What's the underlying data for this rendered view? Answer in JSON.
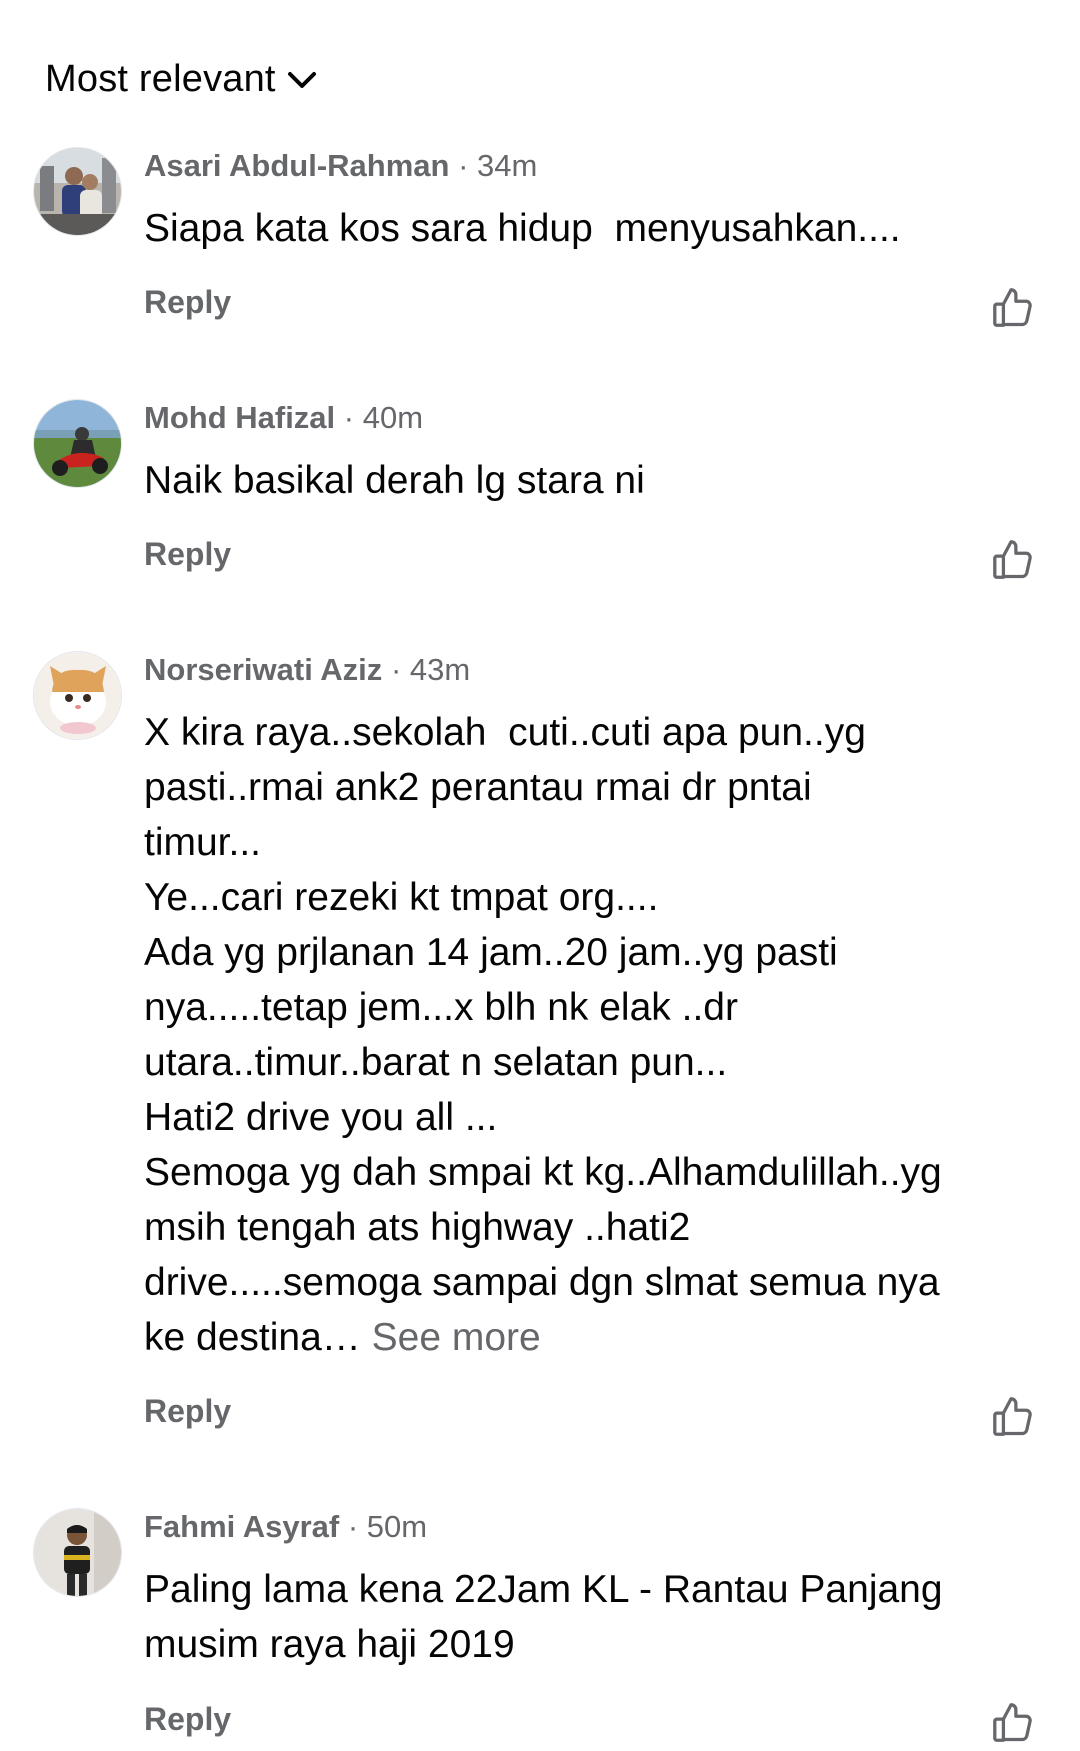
{
  "sort": {
    "label": "Most relevant",
    "icon": "chevron-down-icon"
  },
  "comments": [
    {
      "author": "Asari Abdul-Rahman",
      "time": "· 34m",
      "text": "Siapa kata kos sara hidup  menyusahkan....",
      "see_more": "",
      "reply_label": "Reply",
      "like_icon": "thumbs-up-icon"
    },
    {
      "author": "Mohd Hafizal",
      "time": "· 40m",
      "text": "Naik basikal derah lg stara ni",
      "see_more": "",
      "reply_label": "Reply",
      "like_icon": "thumbs-up-icon"
    },
    {
      "author": "Norseriwati Aziz",
      "time": "· 43m",
      "text": "X kira raya..sekolah  cuti..cuti apa pun..yg\npasti..rmai ank2 perantau rmai dr pntai\ntimur...\nYe...cari rezeki kt tmpat org....\nAda yg prjlanan 14 jam..20 jam..yg pasti\nnya.....tetap jem...x blh nk elak ..dr\nutara..timur..barat n selatan pun...\nHati2 drive you all ...\nSemoga yg dah smpai kt kg..Alhamdulillah..yg\nmsih tengah ats highway ..hati2\ndrive.....semoga sampai dgn slmat semua nya\nke destina… ",
      "see_more": "See more",
      "reply_label": "Reply",
      "like_icon": "thumbs-up-icon"
    },
    {
      "author": "Fahmi Asyraf",
      "time": "· 50m",
      "text": "Paling lama kena 22Jam KL - Rantau Panjang\nmusim raya haji 2019",
      "see_more": "",
      "reply_label": "Reply",
      "like_icon": "thumbs-up-icon"
    }
  ],
  "colors": {
    "text_primary": "#050505",
    "text_secondary": "#65676b",
    "background": "#ffffff"
  }
}
